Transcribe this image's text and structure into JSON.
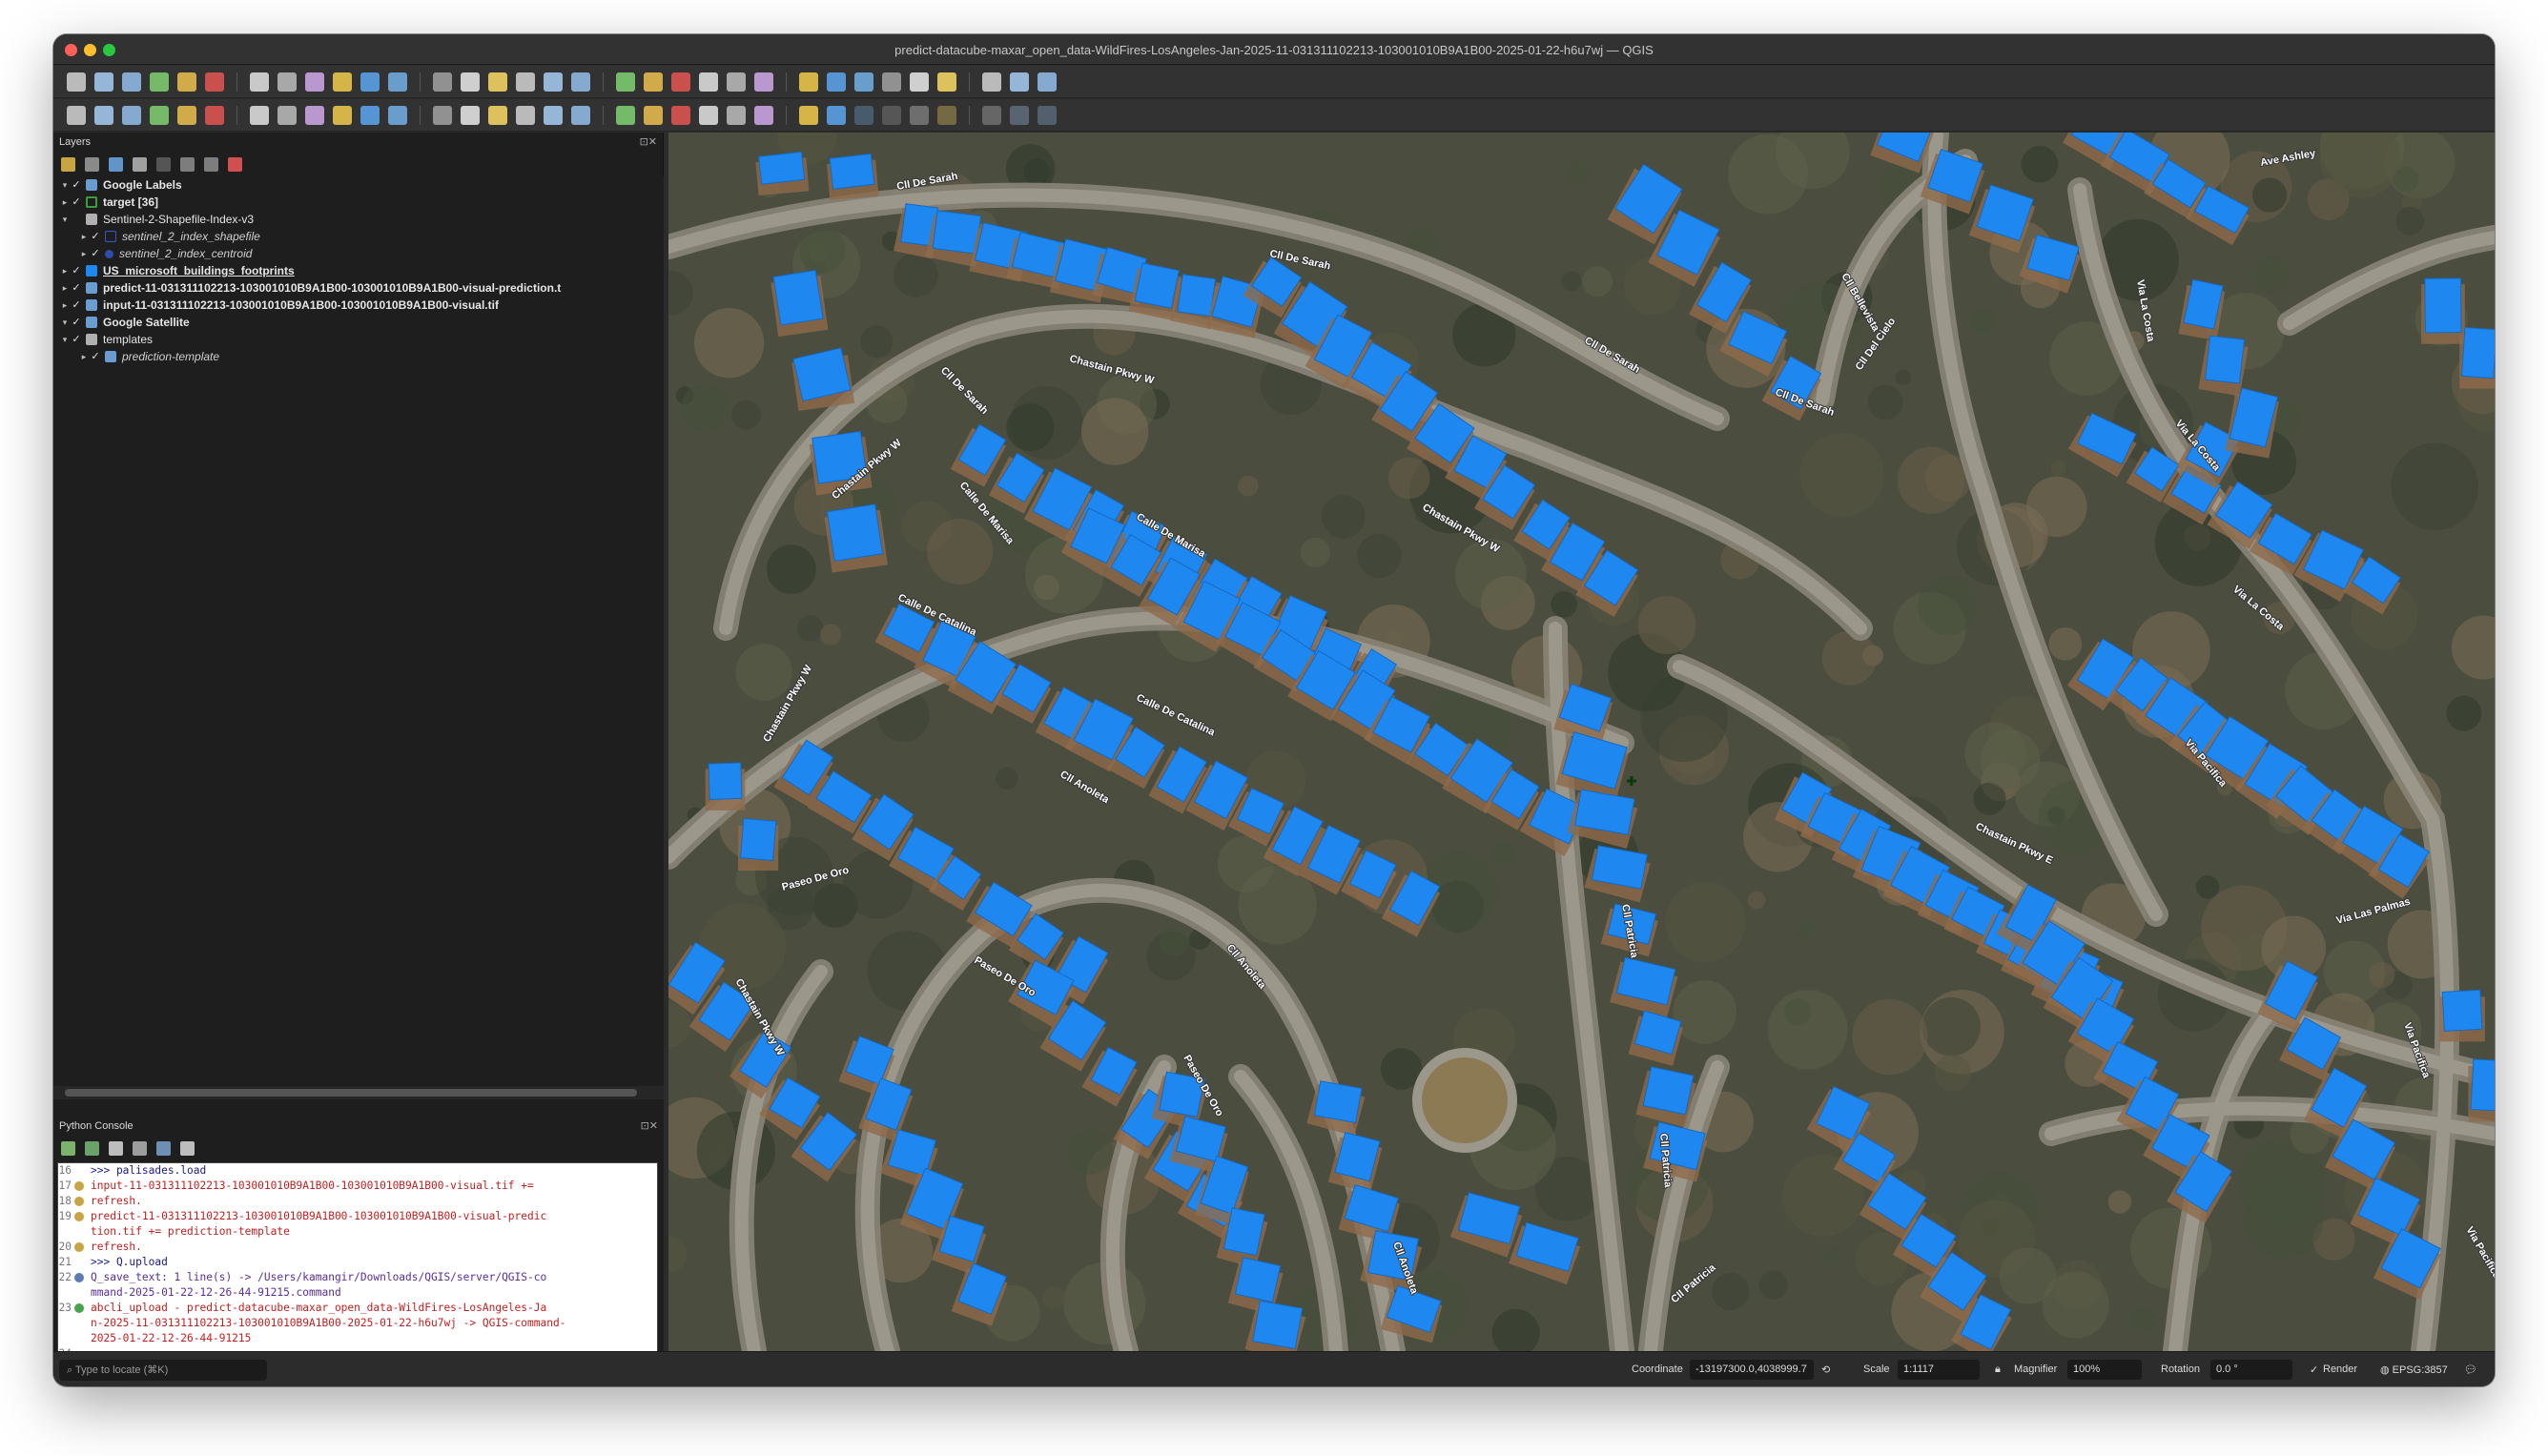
{
  "window": {
    "title": "predict-datacube-maxar_open_data-WildFires-LosAngeles-Jan-2025-11-031311102213-103001010B9A1B00-2025-01-22-h6u7wj — QGIS"
  },
  "layers_panel": {
    "title": "Layers",
    "items": [
      {
        "label": "Google Labels",
        "style": "bold",
        "depth": 0,
        "expanded": true,
        "checked": true,
        "symbol": "xyz-icon"
      },
      {
        "label": "target [36]",
        "style": "bold",
        "depth": 0,
        "expanded": false,
        "checked": true,
        "symbol": "target-layer-icon"
      },
      {
        "label": "Sentinel-2-Shapefile-Index-v3",
        "style": "normal",
        "depth": 0,
        "expanded": true,
        "checked": false,
        "symbol": "group-icon"
      },
      {
        "label": "sentinel_2_index_shapefile",
        "style": "italic",
        "depth": 1,
        "expanded": false,
        "checked": true,
        "symbol": "polygon-outline-icon"
      },
      {
        "label": "sentinel_2_index_centroid",
        "style": "italic",
        "depth": 1,
        "expanded": false,
        "checked": true,
        "symbol": "point-icon"
      },
      {
        "label": "US_microsoft_buildings_footprints",
        "style": "bold-underline",
        "depth": 0,
        "expanded": false,
        "checked": true,
        "symbol": "polygon-fill-icon"
      },
      {
        "label": "predict-11-031311102213-103001010B9A1B00-103001010B9A1B00-visual-prediction.t",
        "style": "bold",
        "depth": 0,
        "expanded": false,
        "checked": true,
        "symbol": "raster-icon"
      },
      {
        "label": "input-11-031311102213-103001010B9A1B00-103001010B9A1B00-visual.tif",
        "style": "bold",
        "depth": 0,
        "expanded": false,
        "checked": true,
        "symbol": "raster-icon"
      },
      {
        "label": "Google Satellite",
        "style": "bold",
        "depth": 0,
        "expanded": true,
        "checked": true,
        "symbol": "xyz-icon"
      },
      {
        "label": "templates",
        "style": "normal",
        "depth": 0,
        "expanded": true,
        "checked": true,
        "symbol": "group-icon"
      },
      {
        "label": "prediction-template",
        "style": "italic",
        "depth": 1,
        "expanded": false,
        "checked": true,
        "symbol": "xyz-icon"
      }
    ]
  },
  "console": {
    "title": "Python Console",
    "lines": [
      {
        "n": "16",
        "text": ">>> palisades.load",
        "kind": "cmd"
      },
      {
        "n": "17",
        "text": "input-11-031311102213-103001010B9A1B00-103001010B9A1B00-visual.tif +=",
        "kind": "info"
      },
      {
        "n": "18",
        "text": "refresh.",
        "kind": "info"
      },
      {
        "n": "19",
        "text": "predict-11-031311102213-103001010B9A1B00-103001010B9A1B00-visual-predic",
        "kind": "info"
      },
      {
        "n": "",
        "text": "tion.tif += prediction-template",
        "kind": "cont"
      },
      {
        "n": "20",
        "text": "refresh.",
        "kind": "info"
      },
      {
        "n": "21",
        "text": ">>> Q.upload",
        "kind": "cmd"
      },
      {
        "n": "22",
        "text": "Q_save_text: 1 line(s) -> /Users/kamangir/Downloads/QGIS/server/QGIS-co",
        "kind": "save"
      },
      {
        "n": "",
        "text": "mmand-2025-01-22-12-26-44-91215.command",
        "kind": "cont"
      },
      {
        "n": "23",
        "text": "abcli_upload - predict-datacube-maxar_open_data-WildFires-LosAngeles-Ja",
        "kind": "upload"
      },
      {
        "n": "",
        "text": "n-2025-11-031311102213-103001010B9A1B00-2025-01-22-h6u7wj -> QGIS-command-",
        "kind": "cont"
      },
      {
        "n": "",
        "text": "2025-01-22-12-26-44-91215",
        "kind": "cont"
      },
      {
        "n": "24",
        "text": "",
        "kind": "blank"
      }
    ],
    "prompt": ">>>"
  },
  "statusbar": {
    "locate_placeholder": "Type to locate (⌘K)",
    "coordinate_label": "Coordinate",
    "coordinate_value": "-13197300.0,4038999.7",
    "scale_label": "Scale",
    "scale_value": "1:1117",
    "magnifier_label": "Magnifier",
    "magnifier_value": "100%",
    "rotation_label": "Rotation",
    "rotation_value": "0.0 °",
    "render_label": "Render",
    "crs_value": "EPSG:3857"
  },
  "map": {
    "street_labels": [
      {
        "text": "Cll De Sarah",
        "key": "s1"
      },
      {
        "text": "Cll De Sarah",
        "key": "s2"
      },
      {
        "text": "Cll De Sarah",
        "key": "s3"
      },
      {
        "text": "Cll De Sarah",
        "key": "s4"
      },
      {
        "text": "Cll De Sarah",
        "key": "s5"
      },
      {
        "text": "Chastain Pkwy W",
        "key": "s6"
      },
      {
        "text": "Chastain Pkwy W",
        "key": "s7"
      },
      {
        "text": "Chastain Pkwy W",
        "key": "s8"
      },
      {
        "text": "Chastain Pkwy W",
        "key": "s9"
      },
      {
        "text": "Calle De Marisa",
        "key": "s10"
      },
      {
        "text": "Calle De Marisa",
        "key": "s11"
      },
      {
        "text": "Calle De Catalina",
        "key": "s12"
      },
      {
        "text": "Calle De Catalina",
        "key": "s13"
      },
      {
        "text": "Cll Anoleta",
        "key": "s14"
      },
      {
        "text": "Cll Anoleta",
        "key": "s15"
      },
      {
        "text": "Paseo De Oro",
        "key": "s16"
      },
      {
        "text": "Paseo De Oro",
        "key": "s17"
      },
      {
        "text": "Paseo De Oro",
        "key": "s18"
      },
      {
        "text": "Chastain Pkwy W",
        "key": "s19"
      },
      {
        "text": "Cll Patricia",
        "key": "s20"
      },
      {
        "text": "Cll Patricia",
        "key": "s21"
      },
      {
        "text": "Cll Patricia",
        "key": "s22"
      },
      {
        "text": "Chastain Pkwy E",
        "key": "s23"
      },
      {
        "text": "Via La Costa",
        "key": "s24"
      },
      {
        "text": "Via La Costa",
        "key": "s25"
      },
      {
        "text": "Via La Costa",
        "key": "s26"
      },
      {
        "text": "Via Pacifica",
        "key": "s27"
      },
      {
        "text": "Via Pacifica",
        "key": "s28"
      },
      {
        "text": "Via Pacifica",
        "key": "s29"
      },
      {
        "text": "Via Las Palmas",
        "key": "s30"
      },
      {
        "text": "Cll Bellevista",
        "key": "s31"
      },
      {
        "text": "Cll Del Cielo",
        "key": "s32"
      },
      {
        "text": "Ave Ashley",
        "key": "s33"
      },
      {
        "text": "Cll Anoleta",
        "key": "s34"
      }
    ],
    "footprint_color": "#1e88f0"
  }
}
